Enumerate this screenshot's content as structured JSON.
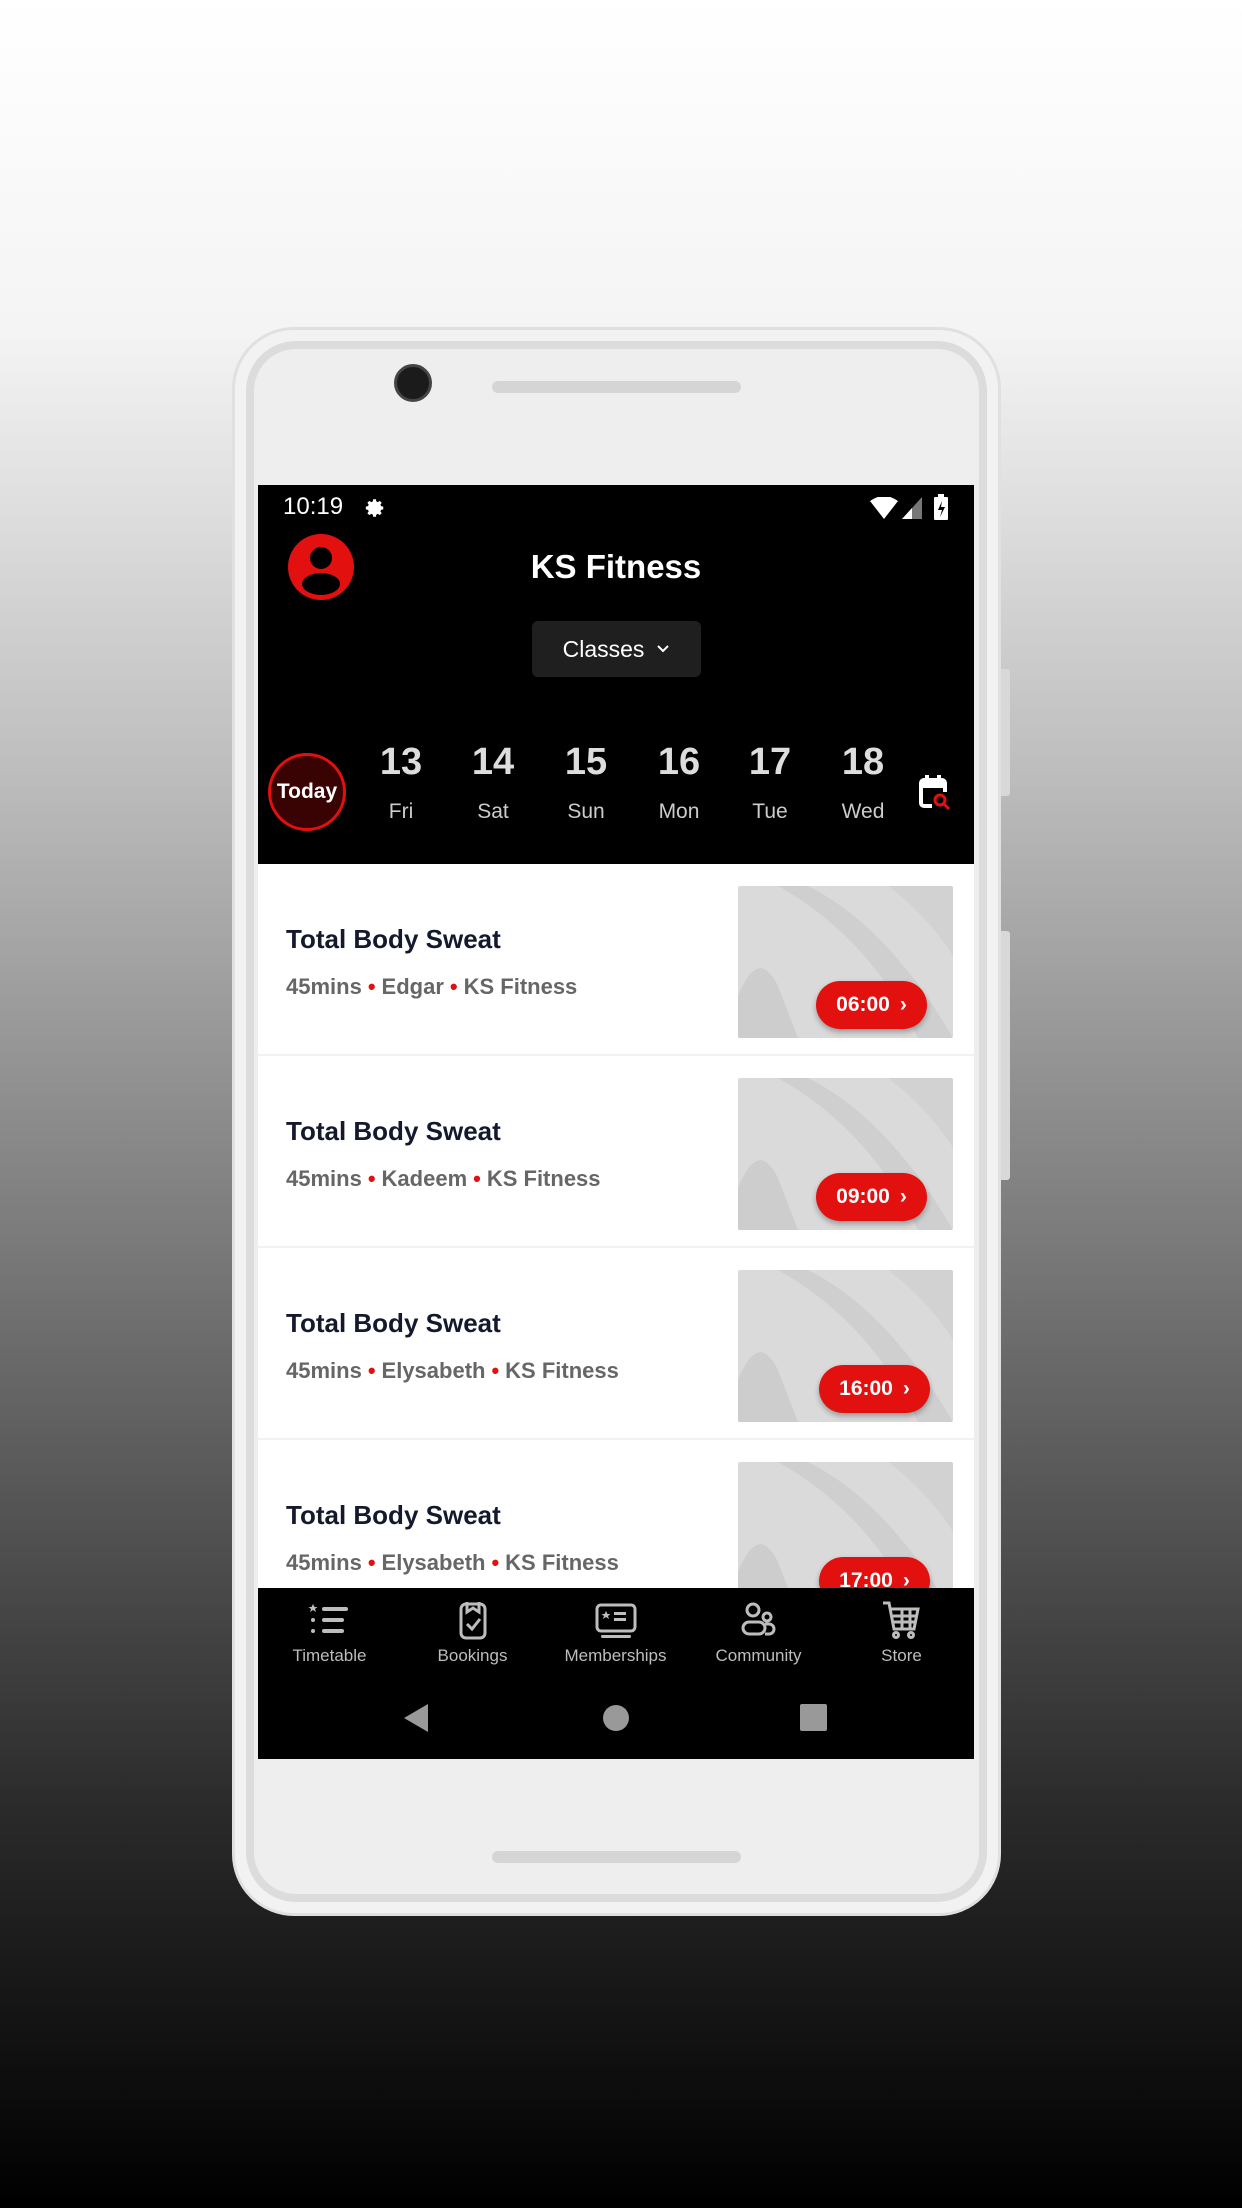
{
  "status_bar": {
    "time": "10:19",
    "icons": [
      "settings-icon",
      "wifi-icon",
      "signal-icon",
      "battery-charging-icon"
    ]
  },
  "header": {
    "title": "KS Fitness",
    "dropdown": {
      "selected": "Classes"
    }
  },
  "dates": {
    "today_label": "Today",
    "days": [
      {
        "num": "13",
        "label": "Fri"
      },
      {
        "num": "14",
        "label": "Sat"
      },
      {
        "num": "15",
        "label": "Sun"
      },
      {
        "num": "16",
        "label": "Mon"
      },
      {
        "num": "17",
        "label": "Tue"
      },
      {
        "num": "18",
        "label": "Wed"
      }
    ]
  },
  "classes": [
    {
      "title": "Total Body Sweat",
      "duration": "45mins",
      "instructor": "Edgar",
      "location": "KS Fitness",
      "time": "06:00"
    },
    {
      "title": "Total Body Sweat",
      "duration": "45mins",
      "instructor": "Kadeem",
      "location": "KS Fitness",
      "time": "09:00"
    },
    {
      "title": "Total Body Sweat",
      "duration": "45mins",
      "instructor": "Elysabeth",
      "location": "KS Fitness",
      "time": "16:00"
    },
    {
      "title": "Total Body Sweat",
      "duration": "45mins",
      "instructor": "Elysabeth",
      "location": "KS Fitness",
      "time": "17:00"
    }
  ],
  "bottom_nav": [
    {
      "label": "Timetable"
    },
    {
      "label": "Bookings"
    },
    {
      "label": "Memberships"
    },
    {
      "label": "Community"
    },
    {
      "label": "Store"
    }
  ],
  "colors": {
    "accent": "#e31010",
    "header_bg": "#000000"
  }
}
